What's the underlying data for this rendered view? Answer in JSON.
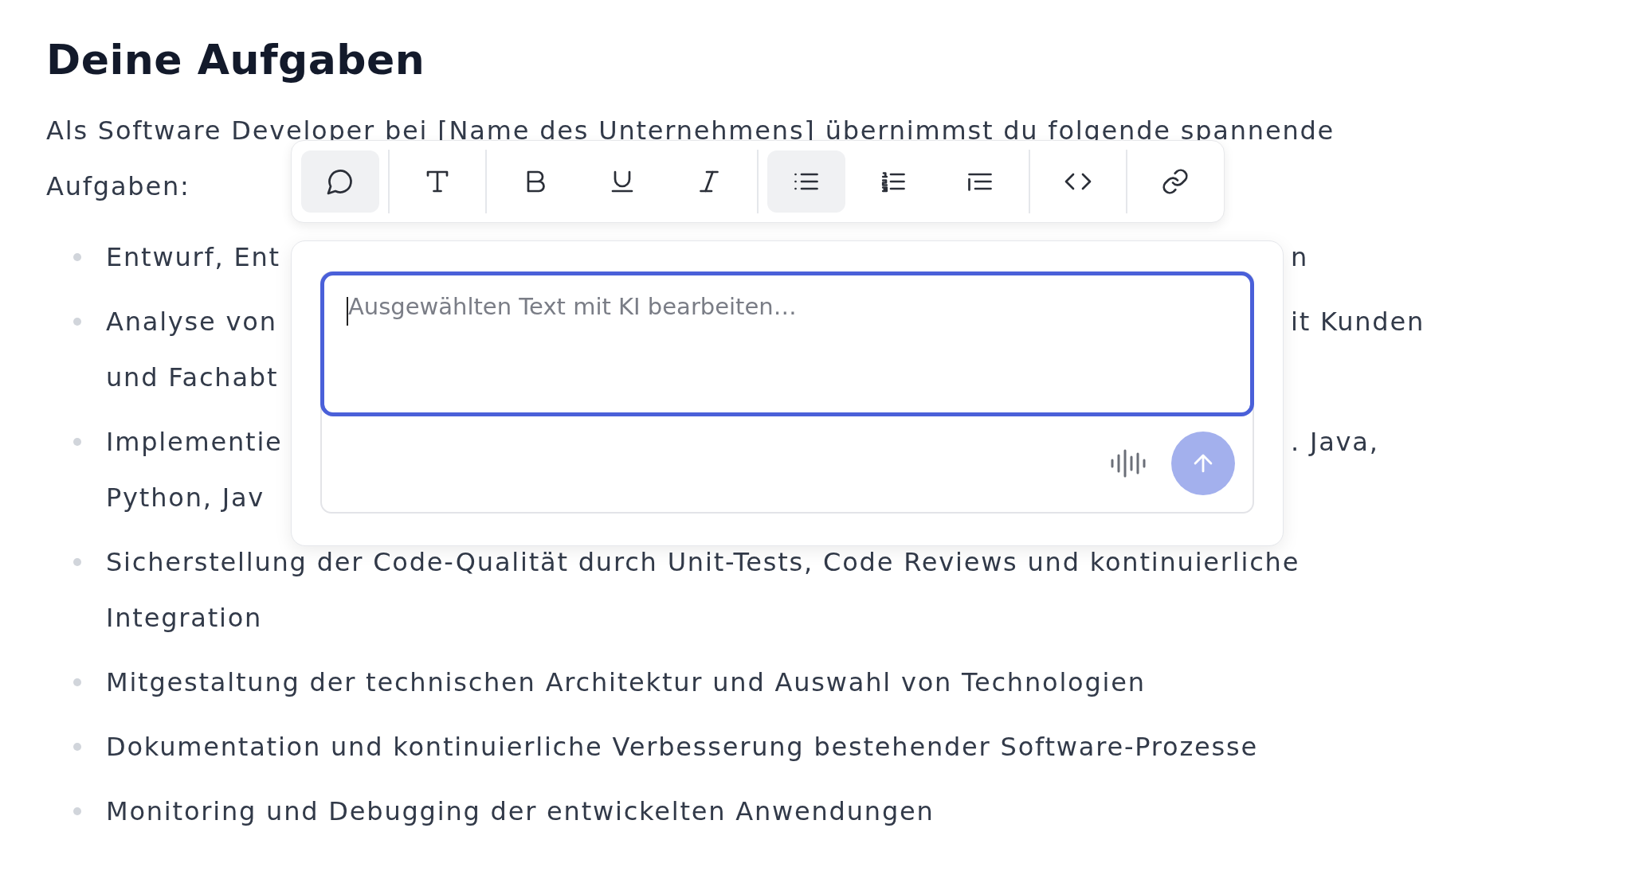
{
  "heading": "Deine Aufgaben",
  "intro": [
    "Als Software Developer bei [Name des Unternehmens] übernimmst du folgende spannende",
    "Aufgaben:"
  ],
  "tasks": [
    {
      "lines": [
        {
          "left": "Entwurf, Ent",
          "right": "n"
        }
      ]
    },
    {
      "lines": [
        {
          "left": "Analyse von",
          "right": "it Kunden"
        },
        {
          "left": "und Fachabt"
        }
      ]
    },
    {
      "lines": [
        {
          "left": "Implementie",
          "right": ". Java,"
        },
        {
          "left": "Python, Jav"
        }
      ]
    },
    {
      "lines": [
        {
          "text": "Sicherstellung der Code-Qualität durch Unit-Tests, Code Reviews und kontinuierliche"
        },
        {
          "text": "Integration"
        }
      ]
    },
    {
      "lines": [
        {
          "text": "Mitgestaltung der technischen Architektur und Auswahl von Technologien"
        }
      ]
    },
    {
      "lines": [
        {
          "text": "Dokumentation und kontinuierliche Verbesserung bestehender Software-Prozesse"
        }
      ]
    },
    {
      "lines": [
        {
          "text": "Monitoring und Debugging der entwickelten Anwendungen"
        }
      ]
    }
  ],
  "toolbar": {
    "groups": [
      [
        {
          "selected": true
        }
      ],
      [
        {
          "selected": false
        }
      ],
      [
        {
          "selected": false
        },
        {
          "selected": false
        },
        {
          "selected": false
        }
      ],
      [
        {
          "selected": true
        },
        {
          "selected": false
        },
        {
          "selected": false
        }
      ],
      [
        {
          "selected": false
        }
      ],
      [
        {
          "selected": false
        }
      ]
    ]
  },
  "ai_prompt": {
    "placeholder": "Ausgewählten Text mit KI bearbeiten…",
    "focused": true,
    "send_disabled": true
  }
}
